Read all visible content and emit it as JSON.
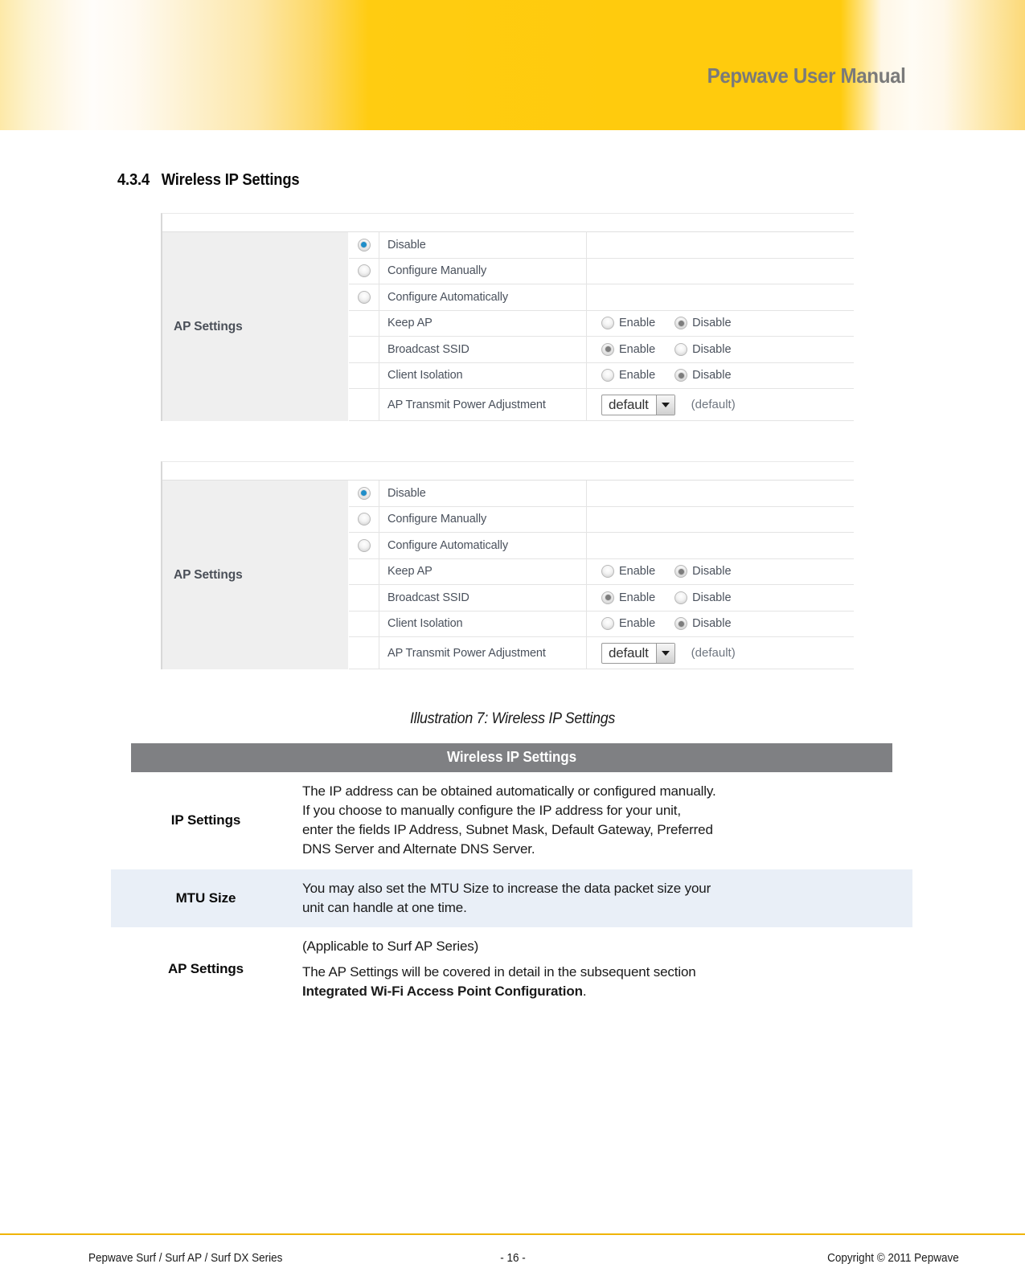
{
  "header": {
    "title": "Pepwave User Manual",
    "accent_color": "#ffcb0d",
    "title_color": "#7a7a7a"
  },
  "section": {
    "number": "4.3.4",
    "title": "Wireless IP Settings"
  },
  "screenshots": [
    {
      "group_label": "AP Settings",
      "mode_options": [
        {
          "label": "Disable",
          "selected": true
        },
        {
          "label": "Configure Manually",
          "selected": false
        },
        {
          "label": "Configure Automatically",
          "selected": false
        }
      ],
      "settings": [
        {
          "label": "Keep AP",
          "type": "enable-disable",
          "enable_label": "Enable",
          "disable_label": "Disable",
          "value": "Disable"
        },
        {
          "label": "Broadcast SSID",
          "type": "enable-disable",
          "enable_label": "Enable",
          "disable_label": "Disable",
          "value": "Enable"
        },
        {
          "label": "Client Isolation",
          "type": "enable-disable",
          "enable_label": "Enable",
          "disable_label": "Disable",
          "value": "Disable"
        },
        {
          "label": "AP Transmit Power Adjustment",
          "type": "select",
          "value": "default",
          "note": "(default)"
        }
      ]
    },
    {
      "group_label": "AP Settings",
      "mode_options": [
        {
          "label": "Disable",
          "selected": true
        },
        {
          "label": "Configure Manually",
          "selected": false
        },
        {
          "label": "Configure Automatically",
          "selected": false
        }
      ],
      "settings": [
        {
          "label": "Keep AP",
          "type": "enable-disable",
          "enable_label": "Enable",
          "disable_label": "Disable",
          "value": "Disable"
        },
        {
          "label": "Broadcast SSID",
          "type": "enable-disable",
          "enable_label": "Enable",
          "disable_label": "Disable",
          "value": "Enable"
        },
        {
          "label": "Client Isolation",
          "type": "enable-disable",
          "enable_label": "Enable",
          "disable_label": "Disable",
          "value": "Disable"
        },
        {
          "label": "AP Transmit Power Adjustment",
          "type": "select",
          "value": "default",
          "note": "(default)"
        }
      ]
    }
  ],
  "caption": "Illustration 7: Wireless IP Settings",
  "desc_table": {
    "header": "Wireless IP Settings",
    "header_bg": "#7f8083",
    "alt_row_bg": "#e9eff7",
    "rows": [
      {
        "key": "IP Settings",
        "shaded": false,
        "lines": [
          {
            "text": "The IP address can be obtained automatically or configured manually."
          },
          {
            "text": "If you choose to manually configure the IP address for your unit,"
          },
          {
            "text": "enter the fields IP Address, Subnet Mask, Default Gateway, Preferred"
          },
          {
            "text": "DNS Server and Alternate DNS Server."
          }
        ]
      },
      {
        "key": "MTU Size",
        "shaded": true,
        "lines": [
          {
            "text": "You may also set the MTU Size to increase the data packet size your"
          },
          {
            "text": "unit can handle at one time."
          }
        ]
      },
      {
        "key": "AP Settings",
        "shaded": false,
        "lines": [
          {
            "text": "(Applicable to Surf AP Series)"
          },
          {
            "text": "The AP Settings will be covered in detail in the subsequent section"
          },
          {
            "text": "",
            "bold_text": "Integrated Wi-Fi Access Point Configuration",
            "suffix": "."
          }
        ]
      }
    ]
  },
  "footer": {
    "left": "Pepwave Surf / Surf AP / Surf DX Series",
    "center": "- 16 -",
    "right": "Copyright © 2011 Pepwave",
    "rule_color": "#f0b400"
  }
}
